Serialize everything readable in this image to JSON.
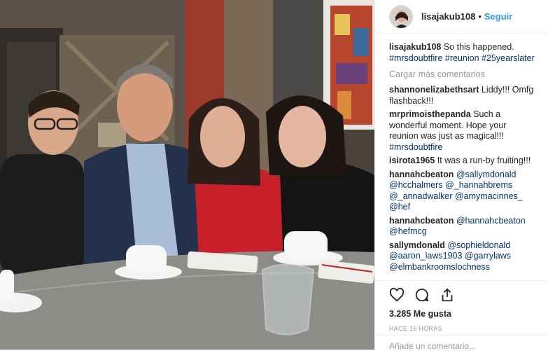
{
  "header": {
    "username": "lisajakub108",
    "separator": "•",
    "follow_label": "Seguir"
  },
  "caption": {
    "username": "lisajakub108",
    "text": "So this happened.",
    "hashtags": "#mrsdoubtfire #reunion #25yearslater"
  },
  "load_more_label": "Cargar más comentarios",
  "comments": [
    {
      "username": "shannonelizabethsart",
      "text": "Liddy!!! Omfg flashback!!!"
    },
    {
      "username": "mrprimoisthepanda",
      "text": "Such a wonderful moment. Hope your reunion was just as magical!!!",
      "tag": "#mrsdoubtfire"
    },
    {
      "username": "isirota1965",
      "text": "It was a run-by fruiting!!!"
    },
    {
      "username": "hannahcbeaton",
      "text": "",
      "tag": "@sallymdonald @hcchalmers @_hannahbrems @_annadwalker @amymacinnes_ @hef"
    },
    {
      "username": "hannahcbeaton",
      "text": "",
      "tag": "@hannahcbeaton @hefmcg"
    },
    {
      "username": "sallymdonald",
      "text": "",
      "tag": "@sophieldonald @aaron_laws1903 @garrylaws @elmbankroomslochness"
    }
  ],
  "likes_label": "3.285 Me gusta",
  "time_label": "HACE 16 HORAS",
  "add_comment_placeholder": "Añade un comentario...",
  "colors": {
    "link": "#003569",
    "follow": "#3897f0",
    "dress_red": "#c8202a"
  },
  "icons": [
    "heart-icon",
    "comment-icon",
    "share-icon"
  ]
}
